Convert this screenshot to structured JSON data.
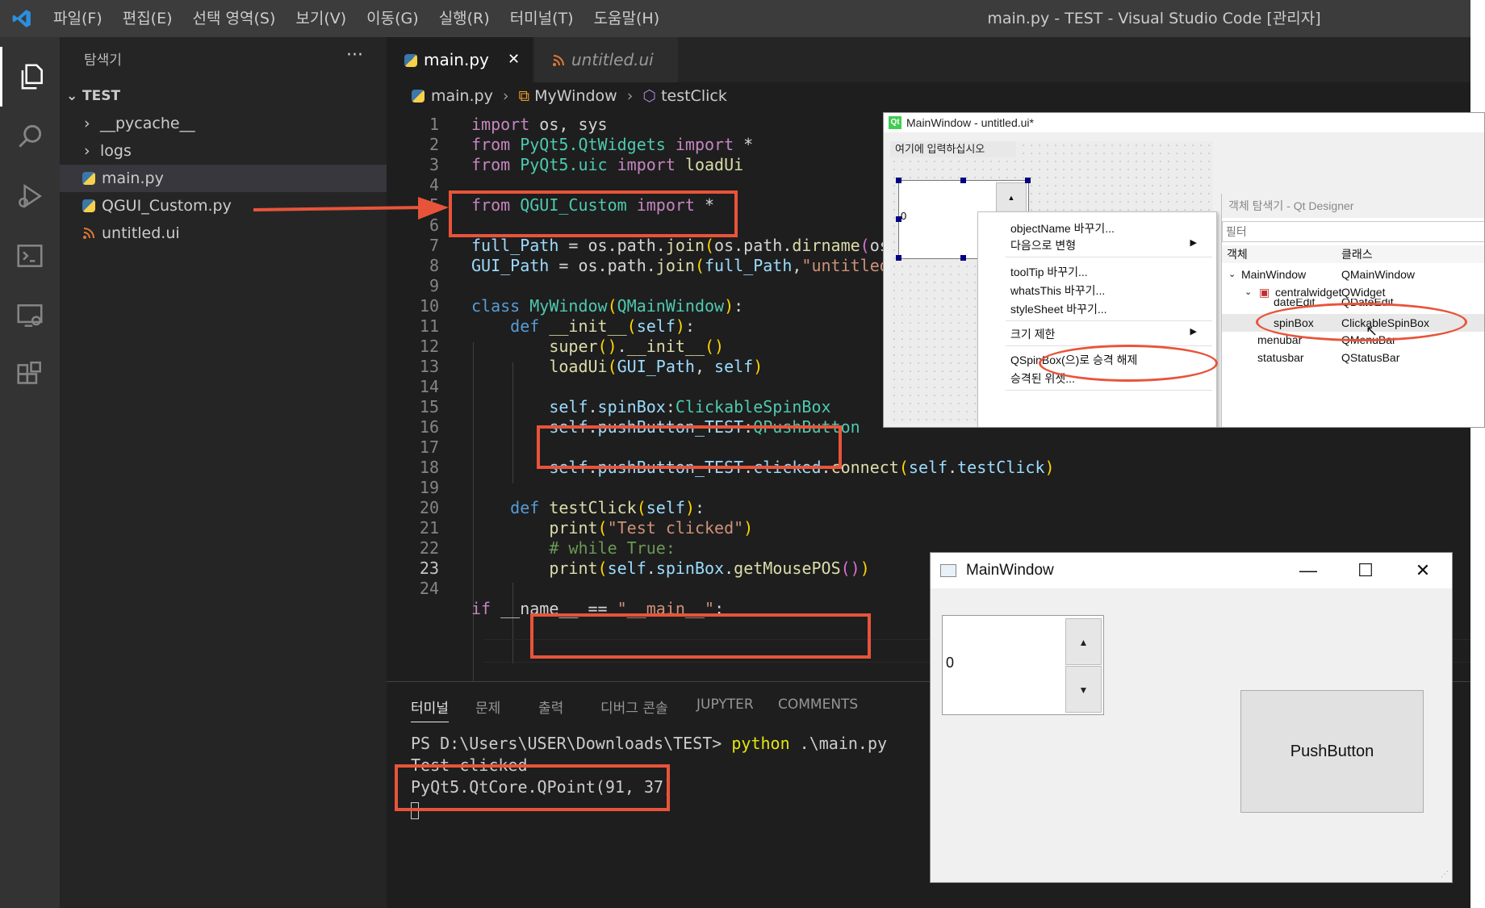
{
  "window": {
    "title": "main.py - TEST - Visual Studio Code [관리자]",
    "menu": [
      "파일(F)",
      "편집(E)",
      "선택 영역(S)",
      "보기(V)",
      "이동(G)",
      "실행(R)",
      "터미널(T)",
      "도움말(H)"
    ]
  },
  "activity_bar": [
    "explorer-icon",
    "search-icon",
    "run-debug-icon",
    "terminal-icon",
    "remote-explorer-icon",
    "extensions-icon"
  ],
  "sidebar": {
    "title": "탐색기",
    "more": "···",
    "root": "TEST",
    "items": [
      {
        "label": "__pycache__",
        "type": "folder"
      },
      {
        "label": "logs",
        "type": "folder"
      },
      {
        "label": "main.py",
        "type": "python",
        "selected": true
      },
      {
        "label": "QGUI_Custom.py",
        "type": "python"
      },
      {
        "label": "untitled.ui",
        "type": "ui"
      }
    ]
  },
  "tabs": [
    {
      "label": "main.py",
      "close": "✕",
      "active": true
    },
    {
      "label": "untitled.ui",
      "active": false
    }
  ],
  "breadcrumb": {
    "file": "main.py",
    "class": "MyWindow",
    "method": "testClick"
  },
  "code": {
    "line_numbers": [
      "1",
      "2",
      "3",
      "4",
      "5",
      "6",
      "7",
      "8",
      "9",
      "10",
      "11",
      "12",
      "13",
      "14",
      "15",
      "16",
      "17",
      "18",
      "19",
      "20",
      "21",
      "22",
      "23",
      "24"
    ],
    "current_line": "23"
  },
  "panel": {
    "tabs": [
      "터미널",
      "문제",
      "출력",
      "디버그 콘솔",
      "JUPYTER",
      "COMMENTS"
    ],
    "terminal": {
      "prompt": "PS D:\\Users\\USER\\Downloads\\TEST> ",
      "command": "python",
      "args": " .\\main.py",
      "output_1": "Test clicked",
      "output_2": "PyQt5.QtCore.QPoint(91, 37)"
    }
  },
  "designer": {
    "title": "MainWindow - untitled.ui*",
    "menu_placeholder": "여기에 입력하십시오",
    "spin_value": "0",
    "context_menu": [
      "objectName 바꾸기...",
      "다음으로 변형",
      "toolTip 바꾸기...",
      "whatsThis 바꾸기...",
      "styleSheet 바꾸기...",
      "크기 제한",
      "QSpinBox(으)로 승격 해제",
      "승격된 위젯..."
    ],
    "object_inspector": {
      "title": "객체 탐색기 - Qt Designer",
      "filter": "필터",
      "col_object": "객체",
      "col_class": "클래스",
      "rows": [
        {
          "object": "MainWindow",
          "class": "QMainWindow"
        },
        {
          "object": "centralwidget",
          "class": "QWidget"
        },
        {
          "object": "dateEdit",
          "class": "QDateEdit"
        },
        {
          "object": "spinBox",
          "class": "ClickableSpinBox"
        },
        {
          "object": "menubar",
          "class": "QMenuBar"
        },
        {
          "object": "statusbar",
          "class": "QStatusBar"
        }
      ]
    }
  },
  "mainwindow": {
    "title": "MainWindow",
    "minimize": "—",
    "maximize": "☐",
    "close": "✕",
    "spin_value": "0",
    "button": "PushButton"
  }
}
